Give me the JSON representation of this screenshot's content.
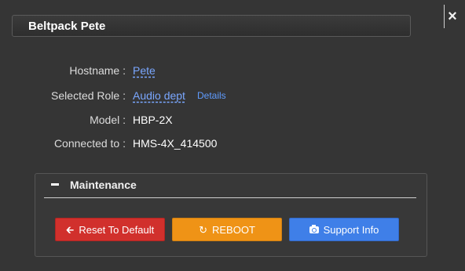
{
  "dialog": {
    "title": "Beltpack Pete",
    "close_glyph": "×"
  },
  "fields": {
    "hostname": {
      "label": "Hostname :",
      "value": "Pete"
    },
    "role": {
      "label": "Selected Role :",
      "value": "Audio dept",
      "details_link": "Details"
    },
    "model": {
      "label": "Model :",
      "value": "HBP-2X"
    },
    "connected": {
      "label": "Connected to :",
      "value": "HMS-4X_414500"
    }
  },
  "maintenance": {
    "title": "Maintenance",
    "buttons": {
      "reset": {
        "label": "Reset To Default",
        "icon": "arrow-left-icon",
        "color": "#d1302c"
      },
      "reboot": {
        "label": "REBOOT",
        "icon": "refresh-icon",
        "color": "#ef9316"
      },
      "support": {
        "label": "Support Info",
        "icon": "camera-icon",
        "color": "#3f7fe8"
      }
    }
  },
  "colors": {
    "background": "#353535",
    "link": "#7aa7ff"
  }
}
